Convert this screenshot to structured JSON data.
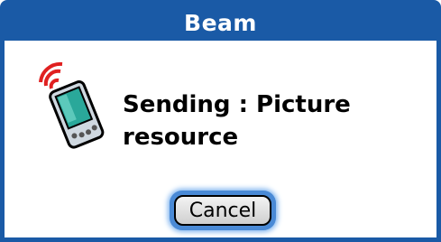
{
  "dialog": {
    "title": "Beam",
    "message_line1": "Sending : Picture",
    "message_line2": "resource",
    "icon": "beam-handheld-icon"
  },
  "buttons": {
    "cancel_label": "Cancel"
  },
  "colors": {
    "title_bar": "#1a5aa6",
    "beam_waves": "#e02020",
    "device_screen": "#2aa89a",
    "button_glow": "#4a8ad6"
  }
}
